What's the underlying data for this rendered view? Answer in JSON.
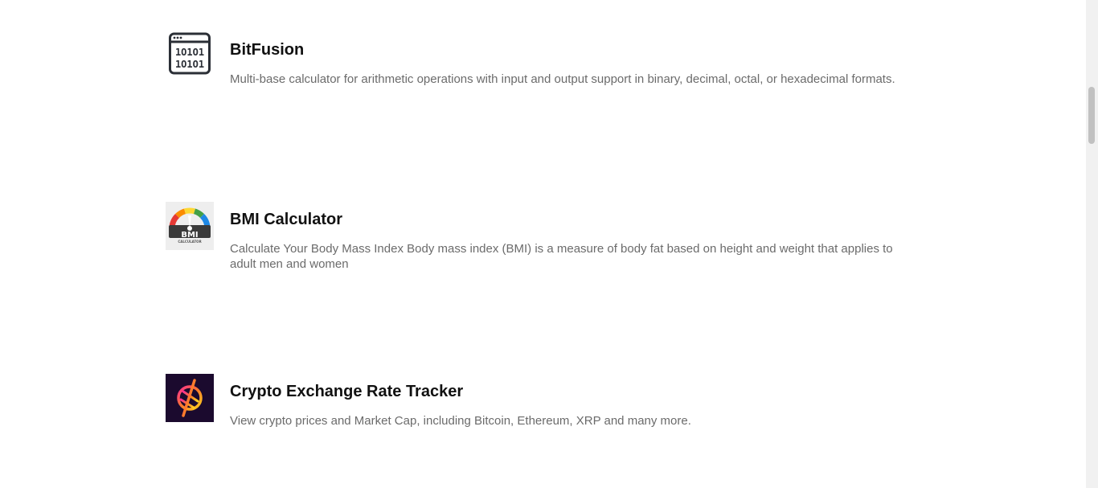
{
  "apps": [
    {
      "title": "BitFusion",
      "description": "Multi-base calculator for arithmetic operations with input and output support in binary, decimal, octal, or hexadecimal formats.",
      "icon": "binary-window-icon"
    },
    {
      "title": "BMI Calculator",
      "description": "Calculate Your Body Mass Index Body mass index (BMI) is a measure of body fat based on height and weight that applies to adult men and women",
      "icon": "bmi-gauge-icon",
      "icon_text": "BMI",
      "icon_subtext": "CALCULATOR"
    },
    {
      "title": "Crypto Exchange Rate Tracker",
      "description": "View crypto prices and Market Cap, including Bitcoin, Ethereum, XRP and many more.",
      "icon": "crypto-logo-icon"
    }
  ],
  "colors": {
    "title": "#111111",
    "description": "#6b6b6b",
    "crypto_bg": "#1b0a2e"
  }
}
